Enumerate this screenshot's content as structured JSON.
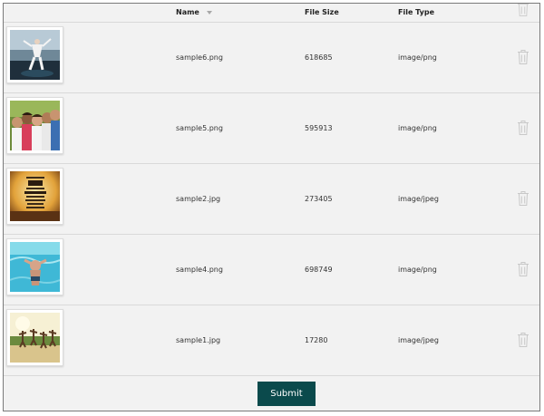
{
  "table": {
    "headers": {
      "name": "Name",
      "size": "File Size",
      "type": "File Type"
    },
    "rows": [
      {
        "name": "sample6.png",
        "size": "618685",
        "type": "image/png",
        "thumb": "stadium-jump-photo"
      },
      {
        "name": "sample5.png",
        "size": "595913",
        "type": "image/png",
        "thumb": "group-of-friends-photo"
      },
      {
        "name": "sample2.jpg",
        "size": "273405",
        "type": "image/jpeg",
        "thumb": "quote-poster-photo"
      },
      {
        "name": "sample4.png",
        "size": "698749",
        "type": "image/png",
        "thumb": "swimmer-underwater-photo"
      },
      {
        "name": "sample1.jpg",
        "size": "17280",
        "type": "image/jpeg",
        "thumb": "beach-jump-photo"
      }
    ]
  },
  "actions": {
    "submit": "Submit"
  },
  "colors": {
    "submit_bg": "#0b4a4c",
    "panel_bg": "#f2f2f2",
    "trash_icon": "#c8c8c8"
  }
}
